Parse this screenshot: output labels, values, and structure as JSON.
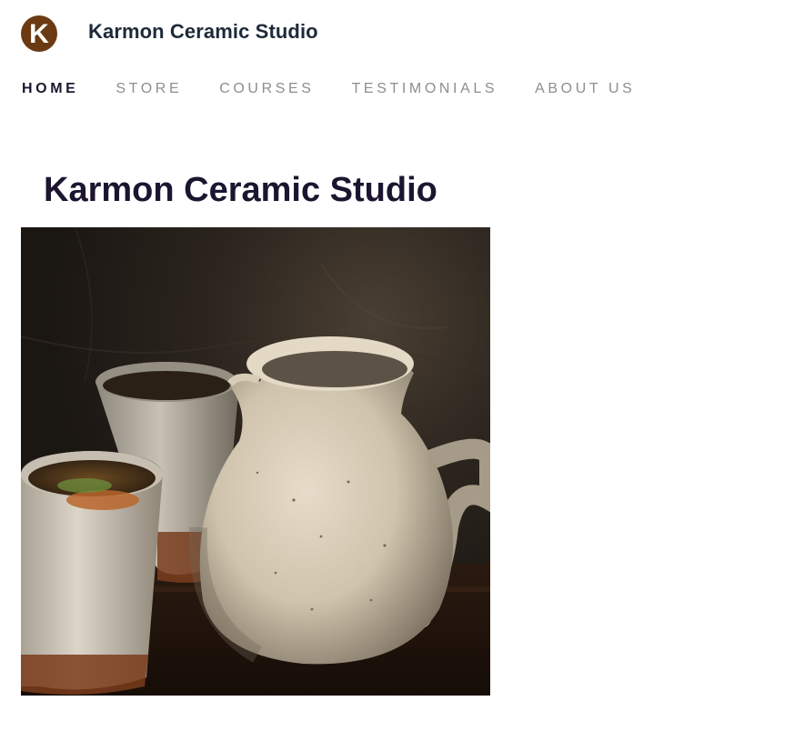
{
  "header": {
    "logo_letter": "K",
    "site_title": "Karmon Ceramic Studio"
  },
  "nav": {
    "items": [
      {
        "label": "HOME",
        "active": true
      },
      {
        "label": "STORE",
        "active": false
      },
      {
        "label": "COURSES",
        "active": false
      },
      {
        "label": "TESTIMONIALS",
        "active": false
      },
      {
        "label": "ABOUT US",
        "active": false
      }
    ]
  },
  "main": {
    "page_title": "Karmon Ceramic Studio"
  },
  "colors": {
    "logo_bg": "#6b3a12",
    "title_text": "#1e2a3a",
    "nav_active": "#1a1a2e",
    "nav_inactive": "#8e8e8e",
    "heading": "#1c1530"
  }
}
